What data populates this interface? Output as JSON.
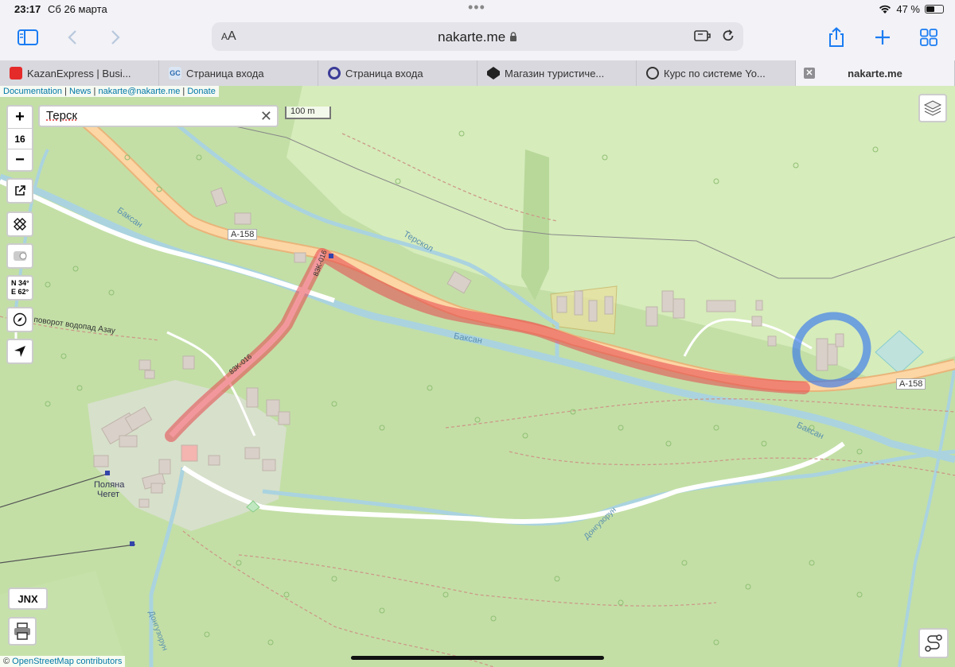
{
  "status": {
    "time": "23:17",
    "date": "Сб 26 марта",
    "battery": "47 %",
    "battery_level": 0.47
  },
  "toolbar": {
    "text_size_label": "AA",
    "url": "nakarte.me"
  },
  "tabs": [
    {
      "label": "KazanExpress | Busi...",
      "favicon_color": "#e52a2a"
    },
    {
      "label": "Страница входа",
      "favicon_color": "#2b6cb0"
    },
    {
      "label": "Страница входа",
      "favicon_color": "#3b3b98"
    },
    {
      "label": "Магазин туристиче...",
      "favicon_color": "#222222"
    },
    {
      "label": "Курс по системе Yo...",
      "favicon_color": "#333333"
    },
    {
      "label": "nakarte.me",
      "active": true
    }
  ],
  "map": {
    "links": [
      "Documentation",
      "News",
      "nakarte@nakarte.me",
      "Donate"
    ],
    "zoom": {
      "plus": "+",
      "level": "16",
      "minus": "−"
    },
    "search_value": "Терск",
    "scale_label": "100 m",
    "coords": {
      "lat": "N 34°",
      "lon": "E 62°"
    },
    "jnx_label": "JNX",
    "attribution": {
      "prefix": "©",
      "name": "OpenStreetMap contributors"
    },
    "labels": {
      "road_a158_1": "A-158",
      "road_a158_2": "A-158",
      "road_83k_1": "83K-016",
      "road_83k_2": "83K-016",
      "river_baksan_1": "Баксан",
      "river_baksan_2": "Баксан",
      "river_baksan_3": "Баксан",
      "river_terskol": "Терскол",
      "river_donguzorun": "Донгузорун",
      "river_donguzorun_2": "Донгузорун",
      "place_cheget_1": "Поляна",
      "place_cheget_2": "Чегет",
      "turn_label": "поворот водопад Азау"
    },
    "colors": {
      "forest": "#c3dfa6",
      "meadow": "#d6ecbb",
      "road_primary": "#fcd6a4",
      "river": "#aad3df",
      "red_annotation": "#e8444d",
      "blue_annotation": "#2a6ff2"
    }
  }
}
